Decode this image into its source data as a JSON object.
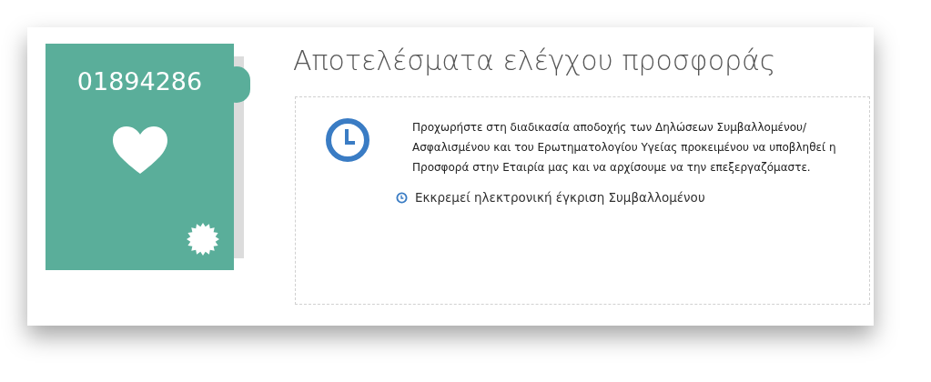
{
  "policy_tile": {
    "number": "01894286"
  },
  "title": "Αποτελέσματα ελέγχου προσφοράς",
  "message": "Προχωρήστε στη διαδικασία αποδοχής των Δηλώσεων Συμβαλλομένου/Ασφαλισμένου και του Ερωτηματολογίου Υγείας προκειμένου να υποβληθεί η Προσφορά στην Εταιρία μας και να αρχίσουμε να την επεξεργαζόμαστε.",
  "status": "Εκκρεμεί ηλεκτρονική έγκριση Συμβαλλομένου"
}
